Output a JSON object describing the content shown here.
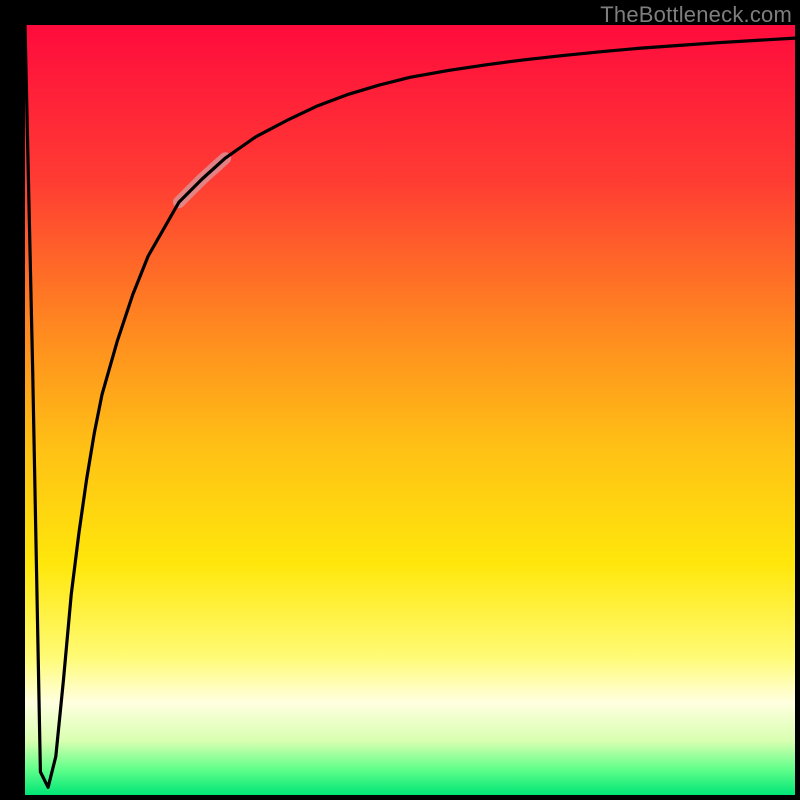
{
  "watermark": "TheBottleneck.com",
  "chart_data": {
    "type": "line",
    "title": "",
    "xlabel": "",
    "ylabel": "",
    "xlim": [
      0,
      1
    ],
    "ylim": [
      0,
      1
    ],
    "x": [
      0.0,
      0.01,
      0.02,
      0.03,
      0.04,
      0.05,
      0.06,
      0.07,
      0.08,
      0.09,
      0.1,
      0.12,
      0.14,
      0.16,
      0.18,
      0.2,
      0.23,
      0.26,
      0.3,
      0.34,
      0.38,
      0.42,
      0.46,
      0.5,
      0.55,
      0.6,
      0.65,
      0.7,
      0.75,
      0.8,
      0.85,
      0.9,
      0.95,
      1.0
    ],
    "values": [
      1.0,
      0.55,
      0.03,
      0.01,
      0.05,
      0.15,
      0.26,
      0.34,
      0.41,
      0.47,
      0.52,
      0.59,
      0.65,
      0.7,
      0.735,
      0.77,
      0.8,
      0.827,
      0.855,
      0.876,
      0.895,
      0.91,
      0.922,
      0.932,
      0.941,
      0.9485,
      0.955,
      0.9605,
      0.9655,
      0.97,
      0.9735,
      0.977,
      0.98,
      0.983
    ],
    "highlight_segment": {
      "x_start": 0.2,
      "x_end": 0.26
    },
    "background_gradient_stops": [
      {
        "offset": 0.0,
        "color": "#ff0b3d"
      },
      {
        "offset": 0.2,
        "color": "#ff3b33"
      },
      {
        "offset": 0.4,
        "color": "#ff8b1f"
      },
      {
        "offset": 0.55,
        "color": "#ffc115"
      },
      {
        "offset": 0.7,
        "color": "#ffe70b"
      },
      {
        "offset": 0.82,
        "color": "#fffb74"
      },
      {
        "offset": 0.88,
        "color": "#ffffe0"
      },
      {
        "offset": 0.93,
        "color": "#d8ffb0"
      },
      {
        "offset": 0.965,
        "color": "#66ff8c"
      },
      {
        "offset": 1.0,
        "color": "#00e676"
      }
    ],
    "legend": [],
    "annotations": []
  }
}
